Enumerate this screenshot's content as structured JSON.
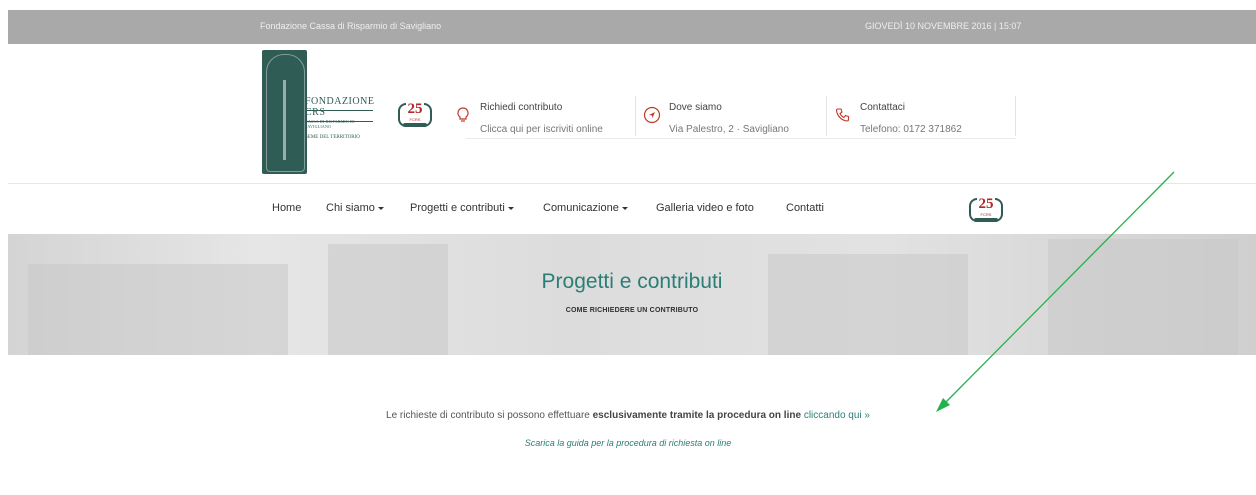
{
  "topbar": {
    "org_name": "Fondazione Cassa di Risparmio di Savigliano",
    "datetime": "GIOVEDÌ 10 NOVEMBRE 2016 | 15:07"
  },
  "logo": {
    "name": "FONDAZIONE CRS",
    "tagline": "CASSA DI RISPARMIO DI SAVIGLIANO",
    "motto": "SEME DEL TERRITORIO"
  },
  "anniversary": {
    "number": "25",
    "label": "FCRS"
  },
  "header_info": [
    {
      "title": "Richiedi contributo",
      "sub": "Clicca qui per iscriviti online",
      "icon": "lightbulb-icon"
    },
    {
      "title": "Dove siamo",
      "sub": "Via Palestro, 2 · Savigliano",
      "icon": "location-arrow-icon"
    },
    {
      "title": "Contattaci",
      "sub": "Telefono: 0172 371862",
      "icon": "phone-icon"
    }
  ],
  "nav": {
    "items": [
      {
        "label": "Home",
        "dropdown": false
      },
      {
        "label": "Chi siamo",
        "dropdown": true
      },
      {
        "label": "Progetti e contributi",
        "dropdown": true
      },
      {
        "label": "Comunicazione",
        "dropdown": true
      },
      {
        "label": "Galleria video e foto",
        "dropdown": false
      },
      {
        "label": "Contatti",
        "dropdown": false
      }
    ]
  },
  "hero": {
    "title": "Progetti e contributi",
    "subtitle": "COME RICHIEDERE UN CONTRIBUTO"
  },
  "content": {
    "text_before": "Le richieste di contributo si possono effettuare ",
    "text_bold": "esclusivamente tramite la procedura on line",
    "link_text": "cliccando qui »",
    "guide_link": "Scarica la guida per la procedura di richiesta on line"
  },
  "colors": {
    "accent": "#2b7e76",
    "brand_dark": "#2f5d56",
    "anniversary_red": "#b3262a",
    "annotation_arrow": "#22b14c"
  }
}
